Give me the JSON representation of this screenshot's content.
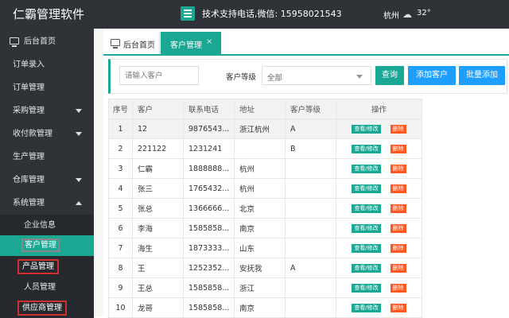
{
  "header": {
    "app_title": "仁霸管理软件",
    "support_text": "技术支持电话,微信: 15958021543",
    "city": "杭州",
    "weather_icon": "cloud-icon",
    "temperature": "32°"
  },
  "sidebar": {
    "items": [
      {
        "label": "后台首页",
        "icon": "monitor-icon"
      },
      {
        "label": "订单录入"
      },
      {
        "label": "订单管理"
      },
      {
        "label": "采购管理"
      },
      {
        "label": "收付款管理"
      },
      {
        "label": "生产管理"
      },
      {
        "label": "仓库管理"
      },
      {
        "label": "系统管理"
      }
    ],
    "sub_items": [
      {
        "label": "企业信息"
      },
      {
        "label": "客户管理"
      },
      {
        "label": "产品管理"
      },
      {
        "label": "人员管理"
      },
      {
        "label": "供应商管理"
      }
    ]
  },
  "tabs": [
    {
      "label": "后台首页",
      "icon": "monitor-icon"
    },
    {
      "label": "客户管理",
      "close": "×"
    }
  ],
  "toolbar": {
    "search_placeholder": "请输入客户",
    "level_label": "客户等级",
    "level_value": "全部",
    "query_label": "查询",
    "add_label": "添加客户",
    "batch_label": "批量添加"
  },
  "table": {
    "columns": [
      "序号",
      "客户",
      "联系电话",
      "地址",
      "客户等级",
      "操作"
    ],
    "edit_label": "查看/修改",
    "delete_label": "删除",
    "rows": [
      {
        "seq": "1",
        "customer": "12",
        "phone": "9876543...",
        "address": "浙江杭州",
        "level": "A"
      },
      {
        "seq": "2",
        "customer": "221122",
        "phone": "1231241",
        "address": "",
        "level": "B"
      },
      {
        "seq": "3",
        "customer": "仁霸",
        "phone": "1888888...",
        "address": "杭州",
        "level": ""
      },
      {
        "seq": "4",
        "customer": "张三",
        "phone": "1765432...",
        "address": "杭州",
        "level": ""
      },
      {
        "seq": "5",
        "customer": "张总",
        "phone": "1366666...",
        "address": "北京",
        "level": ""
      },
      {
        "seq": "6",
        "customer": "李海",
        "phone": "1585858...",
        "address": "南京",
        "level": ""
      },
      {
        "seq": "7",
        "customer": "海生",
        "phone": "1873333...",
        "address": "山东",
        "level": ""
      },
      {
        "seq": "8",
        "customer": "王",
        "phone": "1252352...",
        "address": "安抚我",
        "level": "A"
      },
      {
        "seq": "9",
        "customer": "王总",
        "phone": "1585858...",
        "address": "浙江",
        "level": ""
      },
      {
        "seq": "10",
        "customer": "龙哥",
        "phone": "1585858...",
        "address": "南京",
        "level": ""
      }
    ]
  },
  "colors": {
    "accent": "#1aa894",
    "dark": "#2f3337",
    "blue": "#1e9fff",
    "danger": "#ff5722"
  }
}
